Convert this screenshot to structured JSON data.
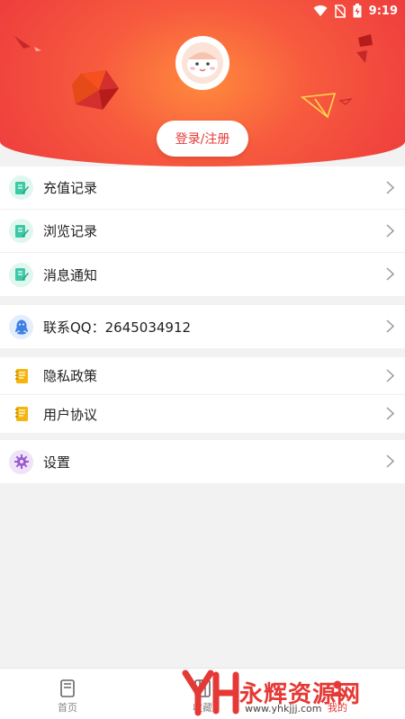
{
  "status_bar": {
    "time": "9:19"
  },
  "header": {
    "login_label": "登录/注册"
  },
  "menu": {
    "group1": [
      {
        "label": "充值记录",
        "icon": "edit-icon"
      },
      {
        "label": "浏览记录",
        "icon": "edit-icon"
      },
      {
        "label": "消息通知",
        "icon": "edit-icon"
      }
    ],
    "group2": [
      {
        "label": "联系QQ：2645034912",
        "icon": "qq-icon"
      }
    ],
    "group3": [
      {
        "label": "隐私政策",
        "icon": "notebook-icon"
      },
      {
        "label": "用户协议",
        "icon": "notebook-icon"
      }
    ],
    "group4": [
      {
        "label": "设置",
        "icon": "gear-icon"
      }
    ]
  },
  "tabbar": {
    "tabs": [
      {
        "label": "首页"
      },
      {
        "label": "收藏"
      },
      {
        "label": "我的"
      }
    ]
  },
  "watermark": {
    "text": "永辉资源网",
    "url": "www.yhkjjj.com"
  },
  "colors": {
    "accent": "#e53935",
    "header_center": "#ff8a3d",
    "header_edge": "#ee3d3d",
    "teal": "#3cc9a6",
    "gold": "#f5b50e",
    "purple": "#9b59d0",
    "blue": "#3f7fe6"
  }
}
